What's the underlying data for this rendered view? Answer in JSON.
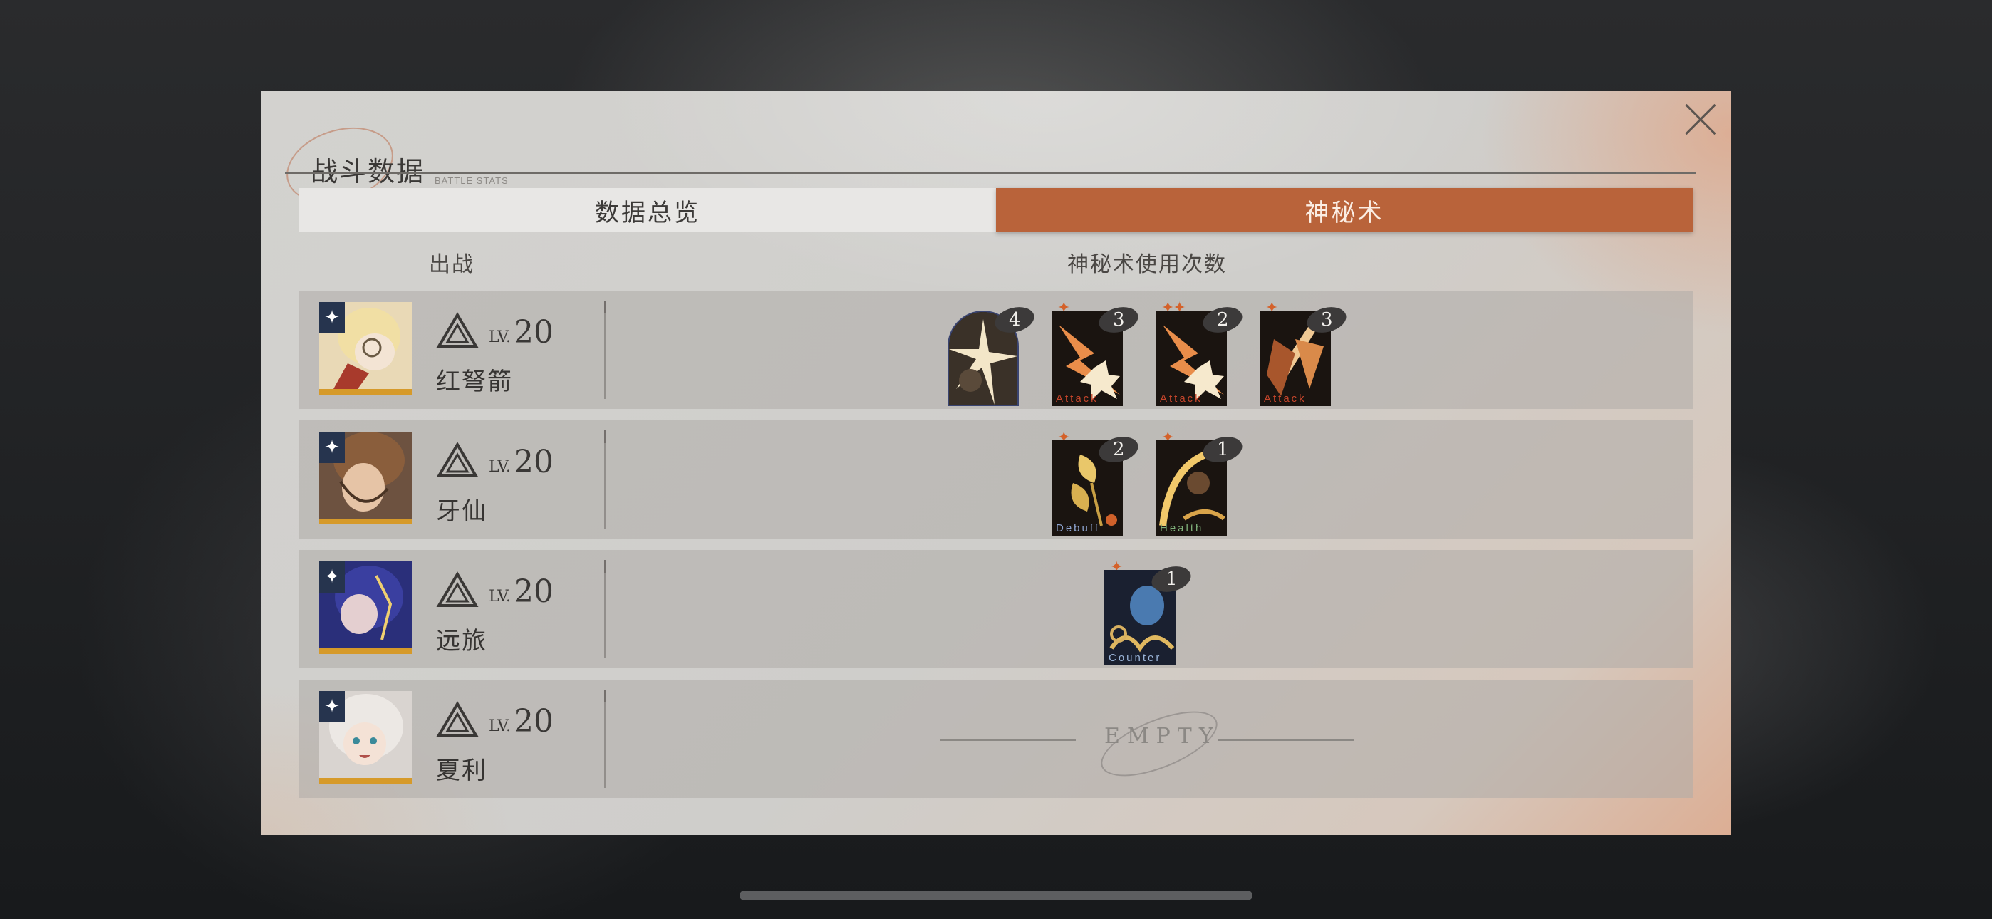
{
  "header": {
    "title": "战斗数据",
    "subtitle": "BATTLE STATS",
    "close_icon": "close-icon"
  },
  "tabs": [
    {
      "label": "数据总览",
      "active": false
    },
    {
      "label": "神秘术",
      "active": true
    }
  ],
  "columns": {
    "deploy": "出战",
    "usage": "神秘术使用次数"
  },
  "colors": {
    "accent": "#b9633a",
    "star": "#d4612a",
    "card_attack_text": "#c5452b",
    "card_debuff_text": "#8da3cf",
    "card_health_text": "#7fb07a",
    "card_counter_text": "#9ab4d8"
  },
  "rows": [
    {
      "lv_prefix": "LV.",
      "level": "20",
      "name": "红弩箭",
      "cards": [
        {
          "icon": "ultimate-card",
          "stars": "",
          "count": "4",
          "label": ""
        },
        {
          "icon": "attack-card",
          "stars": "✦",
          "count": "3",
          "label": "Attack"
        },
        {
          "icon": "attack-card",
          "stars": "✦✦",
          "count": "2",
          "label": "Attack"
        },
        {
          "icon": "attack-card",
          "stars": "✦",
          "count": "3",
          "label": "Attack"
        }
      ]
    },
    {
      "lv_prefix": "LV.",
      "level": "20",
      "name": "牙仙",
      "cards": [
        {
          "icon": "debuff-card",
          "stars": "✦",
          "count": "2",
          "label": "Debuff"
        },
        {
          "icon": "health-card",
          "stars": "✦",
          "count": "1",
          "label": "Health"
        }
      ]
    },
    {
      "lv_prefix": "LV.",
      "level": "20",
      "name": "远旅",
      "cards": [
        {
          "icon": "counter-card",
          "stars": "✦",
          "count": "1",
          "label": "Counter"
        }
      ]
    },
    {
      "lv_prefix": "LV.",
      "level": "20",
      "name": "夏利",
      "cards": [],
      "empty_text": "EMPTY"
    }
  ]
}
